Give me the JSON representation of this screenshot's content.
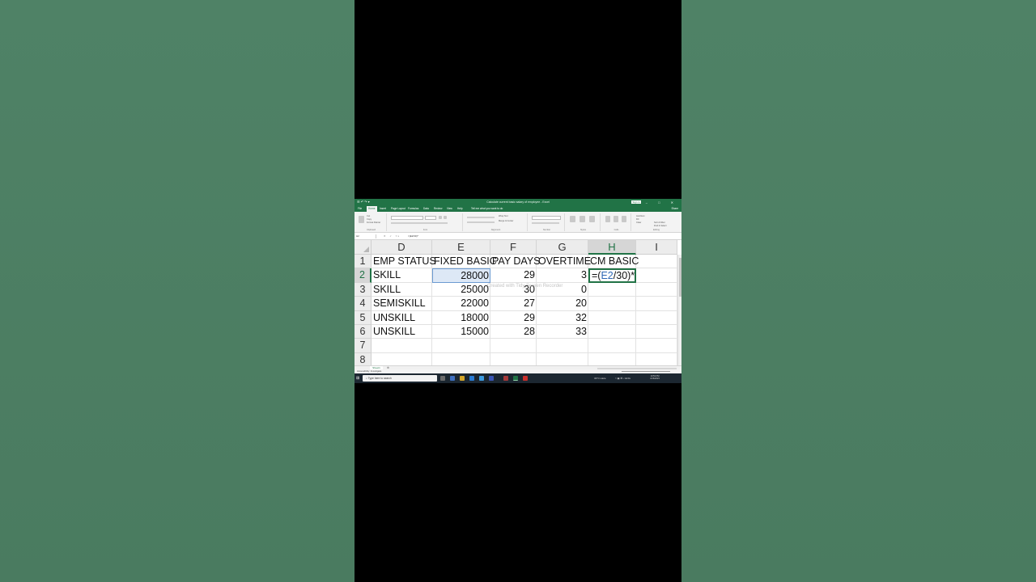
{
  "app": {
    "window_title": "Calculate current basic salary of employee - Excel",
    "quick_access": "☰ ↶ ↷ ▾",
    "sign_in_label": "Sign in",
    "window_controls": "– □ ✕",
    "tabs": [
      {
        "label": "File",
        "active": false
      },
      {
        "label": "Home",
        "active": true
      },
      {
        "label": "Insert",
        "active": false
      },
      {
        "label": "Page Layout",
        "active": false
      },
      {
        "label": "Formulas",
        "active": false
      },
      {
        "label": "Data",
        "active": false
      },
      {
        "label": "Review",
        "active": false
      },
      {
        "label": "View",
        "active": false
      },
      {
        "label": "Help",
        "active": false
      }
    ],
    "tell_me": "Tell me what you want to do",
    "share_label": "Share",
    "ribbon_groups": [
      "Clipboard",
      "Font",
      "Alignment",
      "Number",
      "Styles",
      "Cells",
      "Editing"
    ],
    "ribbon_labels": {
      "cut": "Cut",
      "copy": "Copy",
      "format_painter": "Format Painter",
      "wrap_text": "Wrap Text",
      "merge_center": "Merge & Center",
      "autosum": "AutoSum",
      "fill": "Fill",
      "clear": "Clear",
      "sort_filter": "Sort & Filter",
      "find_select": "Find & Select"
    }
  },
  "formula_bar": {
    "name_box": "H2",
    "fx": "✕ ✓ fx",
    "formula": "=(E2/30)*"
  },
  "sheet": {
    "columns": [
      "D",
      "E",
      "F",
      "G",
      "H",
      "I"
    ],
    "selected_column": "H",
    "row_numbers": [
      "1",
      "2",
      "3",
      "4",
      "5",
      "6",
      "7",
      "8"
    ],
    "selected_row": "2",
    "headers": {
      "d": "EMP STATUS",
      "e": "FIXED BASIC",
      "f": "PAY DAYS",
      "g": "OVERTIME",
      "h": "CM BASIC"
    },
    "rows": [
      {
        "d": "SKILL",
        "e": "28000",
        "f": "29",
        "g": "3"
      },
      {
        "d": "SKILL",
        "e": "25000",
        "f": "30",
        "g": "0"
      },
      {
        "d": "SEMISKILL",
        "e": "22000",
        "f": "27",
        "g": "20"
      },
      {
        "d": "UNSKILL",
        "e": "18000",
        "f": "29",
        "g": "32"
      },
      {
        "d": "UNSKILL",
        "e": "15000",
        "f": "28",
        "g": "33"
      }
    ],
    "active_cell_formula": {
      "prefix": "=(",
      "ref": "E2",
      "suffix": "/30)*"
    },
    "watermark": "Created with Tidy Screen Recorder"
  },
  "sheet_tabs": [
    "Sheet1"
  ],
  "add_sheet": "⊕",
  "status": {
    "text": "Accessibility: Investigate"
  },
  "taskbar": {
    "start": "⊞",
    "search_placeholder": "⌕ Type here to search",
    "weather": "33°C Haze",
    "tray_icons": "˄ ▣ ⌘ ♪ ENG",
    "time": "10:53 PM",
    "date": "3/16/2023"
  },
  "colors": {
    "excel_green": "#217346",
    "selection_fill": "#dde8f6",
    "ref_blue": "#2f68b5",
    "taskbar": "#1c2731",
    "background_green": "#4f8266"
  }
}
